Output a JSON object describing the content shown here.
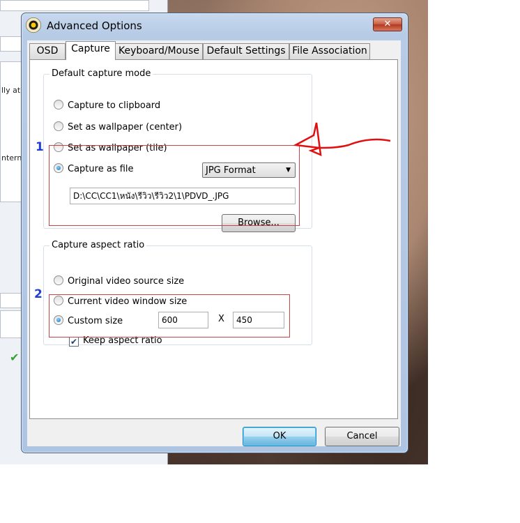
{
  "background_window": {
    "lines": [
      "lly at",
      "ntern"
    ],
    "check_symbol": "✔"
  },
  "dialog": {
    "title": "Advanced Options",
    "close_symbol": "✕",
    "tabs": [
      {
        "label": "OSD",
        "active": false
      },
      {
        "label": "Capture",
        "active": true
      },
      {
        "label": "Keyboard/Mouse",
        "active": false
      },
      {
        "label": "Default Settings",
        "active": false
      },
      {
        "label": "File Association",
        "active": false
      }
    ],
    "capture_mode": {
      "title": "Default capture mode",
      "options": [
        {
          "label": "Capture to clipboard",
          "selected": false
        },
        {
          "label": "Set as wallpaper (center)",
          "selected": false
        },
        {
          "label": "Set as wallpaper (tile)",
          "selected": false
        },
        {
          "label": "Capture as file",
          "selected": true
        }
      ],
      "format": "JPG Format",
      "path": "D:\\CC\\CC1\\หนัง\\รีวิว\\รีวิว2\\1\\PDVD_.JPG",
      "browse_label": "Browse..."
    },
    "aspect_ratio": {
      "title": "Capture aspect ratio",
      "options": [
        {
          "label": "Original video source size",
          "selected": false
        },
        {
          "label": "Current video window size",
          "selected": false
        },
        {
          "label": "Custom size",
          "selected": true
        }
      ],
      "width": "600",
      "separator": "X",
      "height": "450",
      "keep_ratio_label": "Keep aspect ratio",
      "keep_ratio_checked": true
    },
    "ok_label": "OK",
    "cancel_label": "Cancel"
  },
  "annotations": {
    "marker_1": "1",
    "marker_2": "2",
    "highlight_color": "#c94444",
    "arrow_color": "#e01010"
  }
}
